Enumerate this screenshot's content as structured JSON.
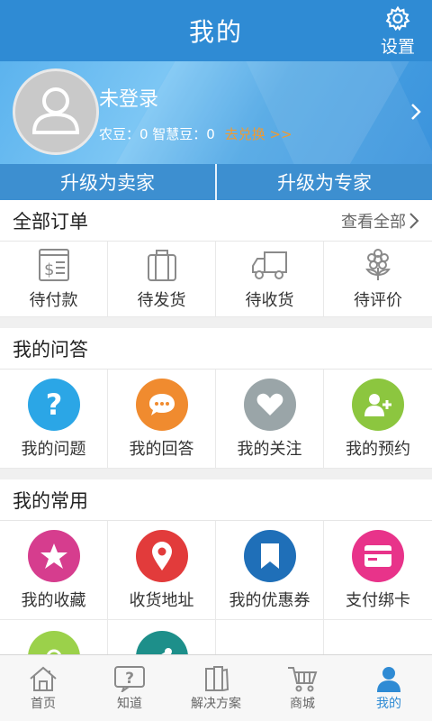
{
  "header": {
    "title": "我的",
    "settings_label": "设置"
  },
  "profile": {
    "login_text": "未登录",
    "beans_text": "农豆：0  智慧豆：0",
    "exchange_link": "去兑换 >>"
  },
  "upgrade": {
    "seller": "升级为卖家",
    "expert": "升级为专家"
  },
  "orders": {
    "title": "全部订单",
    "view_all": "查看全部",
    "items": [
      {
        "label": "待付款",
        "icon": "receipt-icon"
      },
      {
        "label": "待发货",
        "icon": "suitcase-icon"
      },
      {
        "label": "待收货",
        "icon": "truck-icon"
      },
      {
        "label": "待评价",
        "icon": "flower-icon"
      }
    ]
  },
  "qa": {
    "title": "我的问答",
    "items": [
      {
        "label": "我的问题",
        "icon": "question-icon",
        "color": "#2ba6e6"
      },
      {
        "label": "我的回答",
        "icon": "chat-bubble-icon",
        "color": "#f08b2f"
      },
      {
        "label": "我的关注",
        "icon": "heart-icon",
        "color": "#9aa5a8"
      },
      {
        "label": "我的预约",
        "icon": "add-user-icon",
        "color": "#8cc63f"
      }
    ]
  },
  "common": {
    "title": "我的常用",
    "items": [
      {
        "label": "我的收藏",
        "icon": "star-icon",
        "color": "#d63d8e"
      },
      {
        "label": "收货地址",
        "icon": "location-pin-icon",
        "color": "#e23b3b"
      },
      {
        "label": "我的优惠券",
        "icon": "bookmark-icon",
        "color": "#1f6fb8"
      },
      {
        "label": "支付绑卡",
        "icon": "card-icon",
        "color": "#e8338a"
      },
      {
        "label": "",
        "icon": "settings-partial-icon",
        "color": "#9bd14a"
      },
      {
        "label": "",
        "icon": "share-partial-icon",
        "color": "#1d8f8a"
      }
    ]
  },
  "tabbar": {
    "items": [
      {
        "label": "首页",
        "icon": "home-icon"
      },
      {
        "label": "知道",
        "icon": "question-chat-icon"
      },
      {
        "label": "解决方案",
        "icon": "books-icon"
      },
      {
        "label": "商城",
        "icon": "cart-icon"
      },
      {
        "label": "我的",
        "icon": "person-icon",
        "active": true
      }
    ]
  }
}
